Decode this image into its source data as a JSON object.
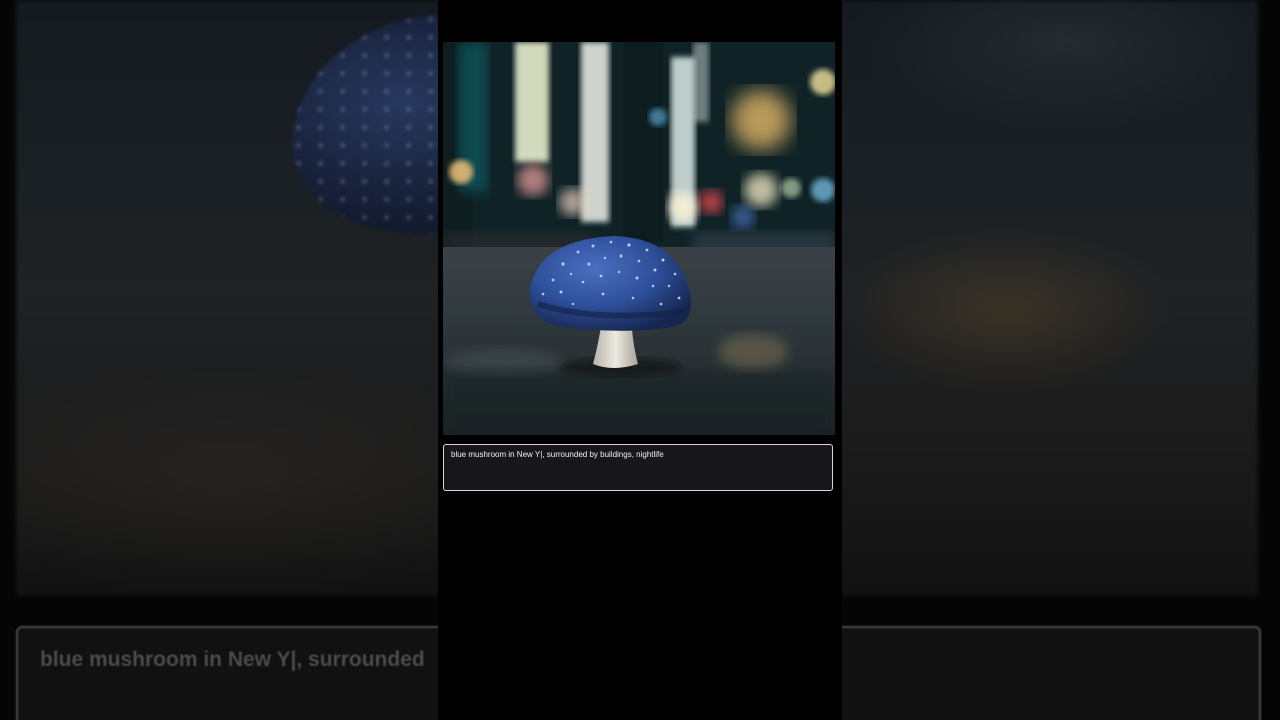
{
  "prompt": {
    "text": "blue mushroom in New Y|, surrounded by buildings, nightlife"
  },
  "background_echo": {
    "text": "blue mushroom in New Y|, surrounded"
  },
  "colors": {
    "mushroom_cap": "#2e4f9a",
    "mushroom_stem": "#d9d6cc",
    "caption_border": "#d8d8d8",
    "caption_bg": "#17171b"
  }
}
